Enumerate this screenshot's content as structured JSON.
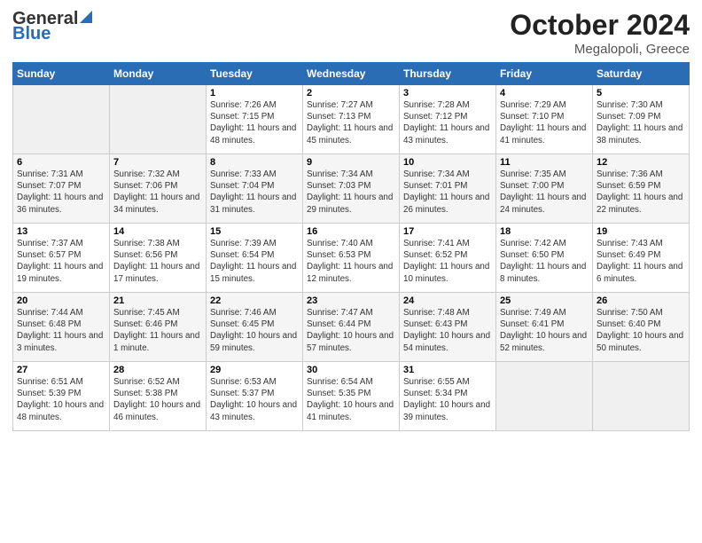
{
  "header": {
    "logo_general": "General",
    "logo_blue": "Blue",
    "title": "October 2024",
    "location": "Megalopoli, Greece"
  },
  "weekdays": [
    "Sunday",
    "Monday",
    "Tuesday",
    "Wednesday",
    "Thursday",
    "Friday",
    "Saturday"
  ],
  "weeks": [
    [
      {
        "num": "",
        "info": ""
      },
      {
        "num": "",
        "info": ""
      },
      {
        "num": "1",
        "info": "Sunrise: 7:26 AM\nSunset: 7:15 PM\nDaylight: 11 hours and 48 minutes."
      },
      {
        "num": "2",
        "info": "Sunrise: 7:27 AM\nSunset: 7:13 PM\nDaylight: 11 hours and 45 minutes."
      },
      {
        "num": "3",
        "info": "Sunrise: 7:28 AM\nSunset: 7:12 PM\nDaylight: 11 hours and 43 minutes."
      },
      {
        "num": "4",
        "info": "Sunrise: 7:29 AM\nSunset: 7:10 PM\nDaylight: 11 hours and 41 minutes."
      },
      {
        "num": "5",
        "info": "Sunrise: 7:30 AM\nSunset: 7:09 PM\nDaylight: 11 hours and 38 minutes."
      }
    ],
    [
      {
        "num": "6",
        "info": "Sunrise: 7:31 AM\nSunset: 7:07 PM\nDaylight: 11 hours and 36 minutes."
      },
      {
        "num": "7",
        "info": "Sunrise: 7:32 AM\nSunset: 7:06 PM\nDaylight: 11 hours and 34 minutes."
      },
      {
        "num": "8",
        "info": "Sunrise: 7:33 AM\nSunset: 7:04 PM\nDaylight: 11 hours and 31 minutes."
      },
      {
        "num": "9",
        "info": "Sunrise: 7:34 AM\nSunset: 7:03 PM\nDaylight: 11 hours and 29 minutes."
      },
      {
        "num": "10",
        "info": "Sunrise: 7:34 AM\nSunset: 7:01 PM\nDaylight: 11 hours and 26 minutes."
      },
      {
        "num": "11",
        "info": "Sunrise: 7:35 AM\nSunset: 7:00 PM\nDaylight: 11 hours and 24 minutes."
      },
      {
        "num": "12",
        "info": "Sunrise: 7:36 AM\nSunset: 6:59 PM\nDaylight: 11 hours and 22 minutes."
      }
    ],
    [
      {
        "num": "13",
        "info": "Sunrise: 7:37 AM\nSunset: 6:57 PM\nDaylight: 11 hours and 19 minutes."
      },
      {
        "num": "14",
        "info": "Sunrise: 7:38 AM\nSunset: 6:56 PM\nDaylight: 11 hours and 17 minutes."
      },
      {
        "num": "15",
        "info": "Sunrise: 7:39 AM\nSunset: 6:54 PM\nDaylight: 11 hours and 15 minutes."
      },
      {
        "num": "16",
        "info": "Sunrise: 7:40 AM\nSunset: 6:53 PM\nDaylight: 11 hours and 12 minutes."
      },
      {
        "num": "17",
        "info": "Sunrise: 7:41 AM\nSunset: 6:52 PM\nDaylight: 11 hours and 10 minutes."
      },
      {
        "num": "18",
        "info": "Sunrise: 7:42 AM\nSunset: 6:50 PM\nDaylight: 11 hours and 8 minutes."
      },
      {
        "num": "19",
        "info": "Sunrise: 7:43 AM\nSunset: 6:49 PM\nDaylight: 11 hours and 6 minutes."
      }
    ],
    [
      {
        "num": "20",
        "info": "Sunrise: 7:44 AM\nSunset: 6:48 PM\nDaylight: 11 hours and 3 minutes."
      },
      {
        "num": "21",
        "info": "Sunrise: 7:45 AM\nSunset: 6:46 PM\nDaylight: 11 hours and 1 minute."
      },
      {
        "num": "22",
        "info": "Sunrise: 7:46 AM\nSunset: 6:45 PM\nDaylight: 10 hours and 59 minutes."
      },
      {
        "num": "23",
        "info": "Sunrise: 7:47 AM\nSunset: 6:44 PM\nDaylight: 10 hours and 57 minutes."
      },
      {
        "num": "24",
        "info": "Sunrise: 7:48 AM\nSunset: 6:43 PM\nDaylight: 10 hours and 54 minutes."
      },
      {
        "num": "25",
        "info": "Sunrise: 7:49 AM\nSunset: 6:41 PM\nDaylight: 10 hours and 52 minutes."
      },
      {
        "num": "26",
        "info": "Sunrise: 7:50 AM\nSunset: 6:40 PM\nDaylight: 10 hours and 50 minutes."
      }
    ],
    [
      {
        "num": "27",
        "info": "Sunrise: 6:51 AM\nSunset: 5:39 PM\nDaylight: 10 hours and 48 minutes."
      },
      {
        "num": "28",
        "info": "Sunrise: 6:52 AM\nSunset: 5:38 PM\nDaylight: 10 hours and 46 minutes."
      },
      {
        "num": "29",
        "info": "Sunrise: 6:53 AM\nSunset: 5:37 PM\nDaylight: 10 hours and 43 minutes."
      },
      {
        "num": "30",
        "info": "Sunrise: 6:54 AM\nSunset: 5:35 PM\nDaylight: 10 hours and 41 minutes."
      },
      {
        "num": "31",
        "info": "Sunrise: 6:55 AM\nSunset: 5:34 PM\nDaylight: 10 hours and 39 minutes."
      },
      {
        "num": "",
        "info": ""
      },
      {
        "num": "",
        "info": ""
      }
    ]
  ]
}
